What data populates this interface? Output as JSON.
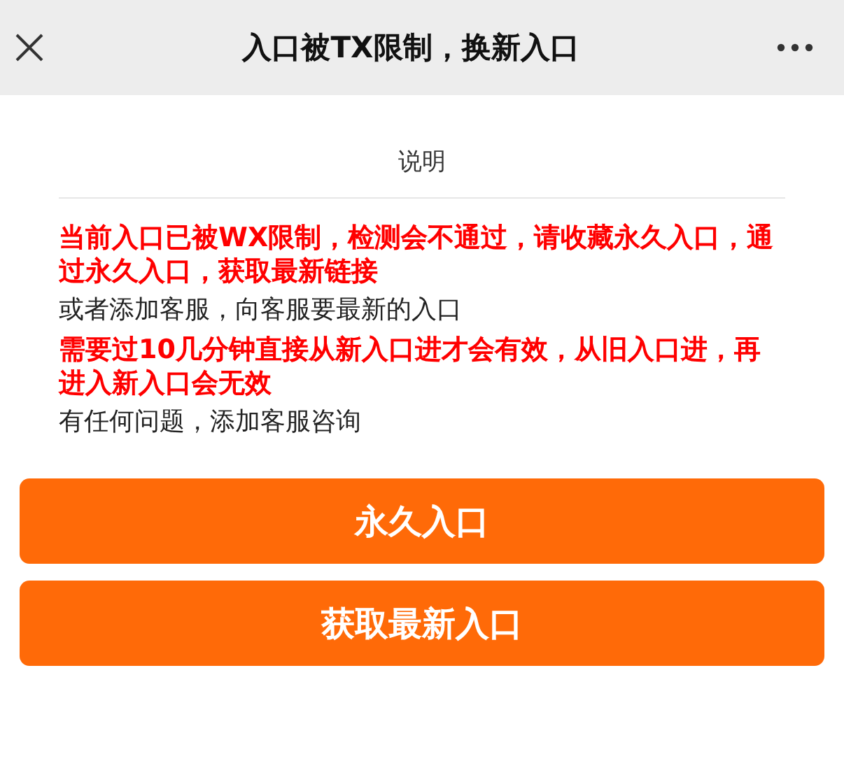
{
  "header": {
    "title": "入口被TX限制，换新入口"
  },
  "section_title": "说明",
  "paragraphs": [
    {
      "kind": "warning",
      "text": "当前入口已被WX限制，检测会不通过，请收藏永久入口，通过永久入口，获取最新链接"
    },
    {
      "kind": "normal",
      "text": "或者添加客服，向客服要最新的入口"
    },
    {
      "kind": "warning",
      "text": "需要过10几分钟直接从新入口进才会有效，从旧入口进，再进入新入口会无效"
    },
    {
      "kind": "normal",
      "text": "有任何问题，添加客服咨询"
    }
  ],
  "buttons": [
    "永久入口",
    "获取最新入口"
  ]
}
